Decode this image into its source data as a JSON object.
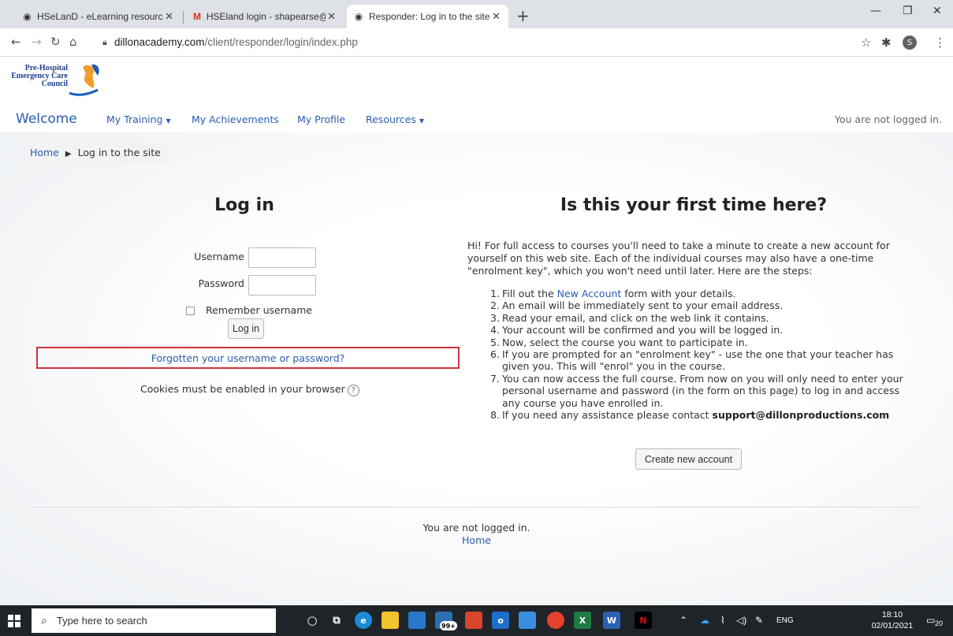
{
  "browser": {
    "tabs": [
      {
        "title": "HSeLanD - eLearning resources",
        "icon": "globe-icon"
      },
      {
        "title": "HSEland login - shapearse@gma",
        "icon": "gmail-icon"
      },
      {
        "title": "Responder: Log in to the site",
        "icon": "globe-icon"
      }
    ],
    "url_host": "dillonacademy.com",
    "url_path": "/client/responder/login/index.php",
    "profile_initial": "S"
  },
  "site": {
    "logo_lines": [
      "Pre-Hospital",
      "Emergency Care",
      "Council"
    ],
    "nav": {
      "welcome": "Welcome",
      "my_training": "My Training",
      "my_achievements": "My Achievements",
      "my_profile": "My Profile",
      "resources": "Resources",
      "status": "You are not logged in."
    },
    "breadcrumb": {
      "home": "Home",
      "current": "Log in to the site"
    }
  },
  "login": {
    "title": "Log in",
    "username_label": "Username",
    "password_label": "Password",
    "remember_label": "Remember username",
    "login_button": "Log in",
    "forgot_link": "Forgotten your username or password?",
    "cookies_text": "Cookies must be enabled in your browser"
  },
  "signup": {
    "title": "Is this your first time here?",
    "intro": "Hi! For full access to courses you'll need to take a minute to create a new account for yourself on this web site. Each of the individual courses may also have a one-time \"enrolment key\", which you won't need until later. Here are the steps:",
    "steps": {
      "s1_pre": "Fill out the ",
      "s1_link": "New Account",
      "s1_post": " form with your details.",
      "s2": "An email will be immediately sent to your email address.",
      "s3": "Read your email, and click on the web link it contains.",
      "s4": "Your account will be confirmed and you will be logged in.",
      "s5": "Now, select the course you want to participate in.",
      "s6": "If you are prompted for an \"enrolment key\" - use the one that your teacher has given you. This will \"enrol\" you in the course.",
      "s7": "You can now access the full course. From now on you will only need to enter your personal username and password (in the form on this page) to log in and access any course you have enrolled in.",
      "s8_pre": "If you need any assistance please contact ",
      "s8_email": "support@dillonproductions.com"
    },
    "create_button": "Create new account"
  },
  "footer": {
    "status": "You are not logged in.",
    "home": "Home"
  },
  "taskbar": {
    "search_placeholder": "Type here to search",
    "badge": "99+",
    "lang": "ENG",
    "time": "18:10",
    "date": "02/01/2021",
    "notifications": "20"
  },
  "colors": {
    "link": "#2a5db0",
    "highlight_border": "#d0333a",
    "taskbar": "#1f2429"
  }
}
